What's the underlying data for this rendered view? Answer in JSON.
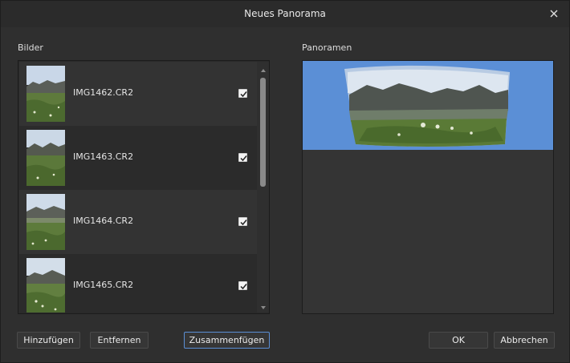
{
  "window": {
    "title": "Neues Panorama",
    "close_icon": "close-icon"
  },
  "sections": {
    "images_label": "Bilder",
    "panoramas_label": "Panoramen"
  },
  "images": [
    {
      "filename": "IMG1462.CR2",
      "checked": true
    },
    {
      "filename": "IMG1463.CR2",
      "checked": true
    },
    {
      "filename": "IMG1464.CR2",
      "checked": true
    },
    {
      "filename": "IMG1465.CR2",
      "checked": true
    }
  ],
  "buttons": {
    "add": "Hinzufügen",
    "remove": "Entfernen",
    "merge": "Zusammenfügen",
    "ok": "OK",
    "cancel": "Abbrechen"
  },
  "colors": {
    "accent": "#5b8fd6",
    "background": "#2f2f2f",
    "panel": "#2a2a2a"
  }
}
